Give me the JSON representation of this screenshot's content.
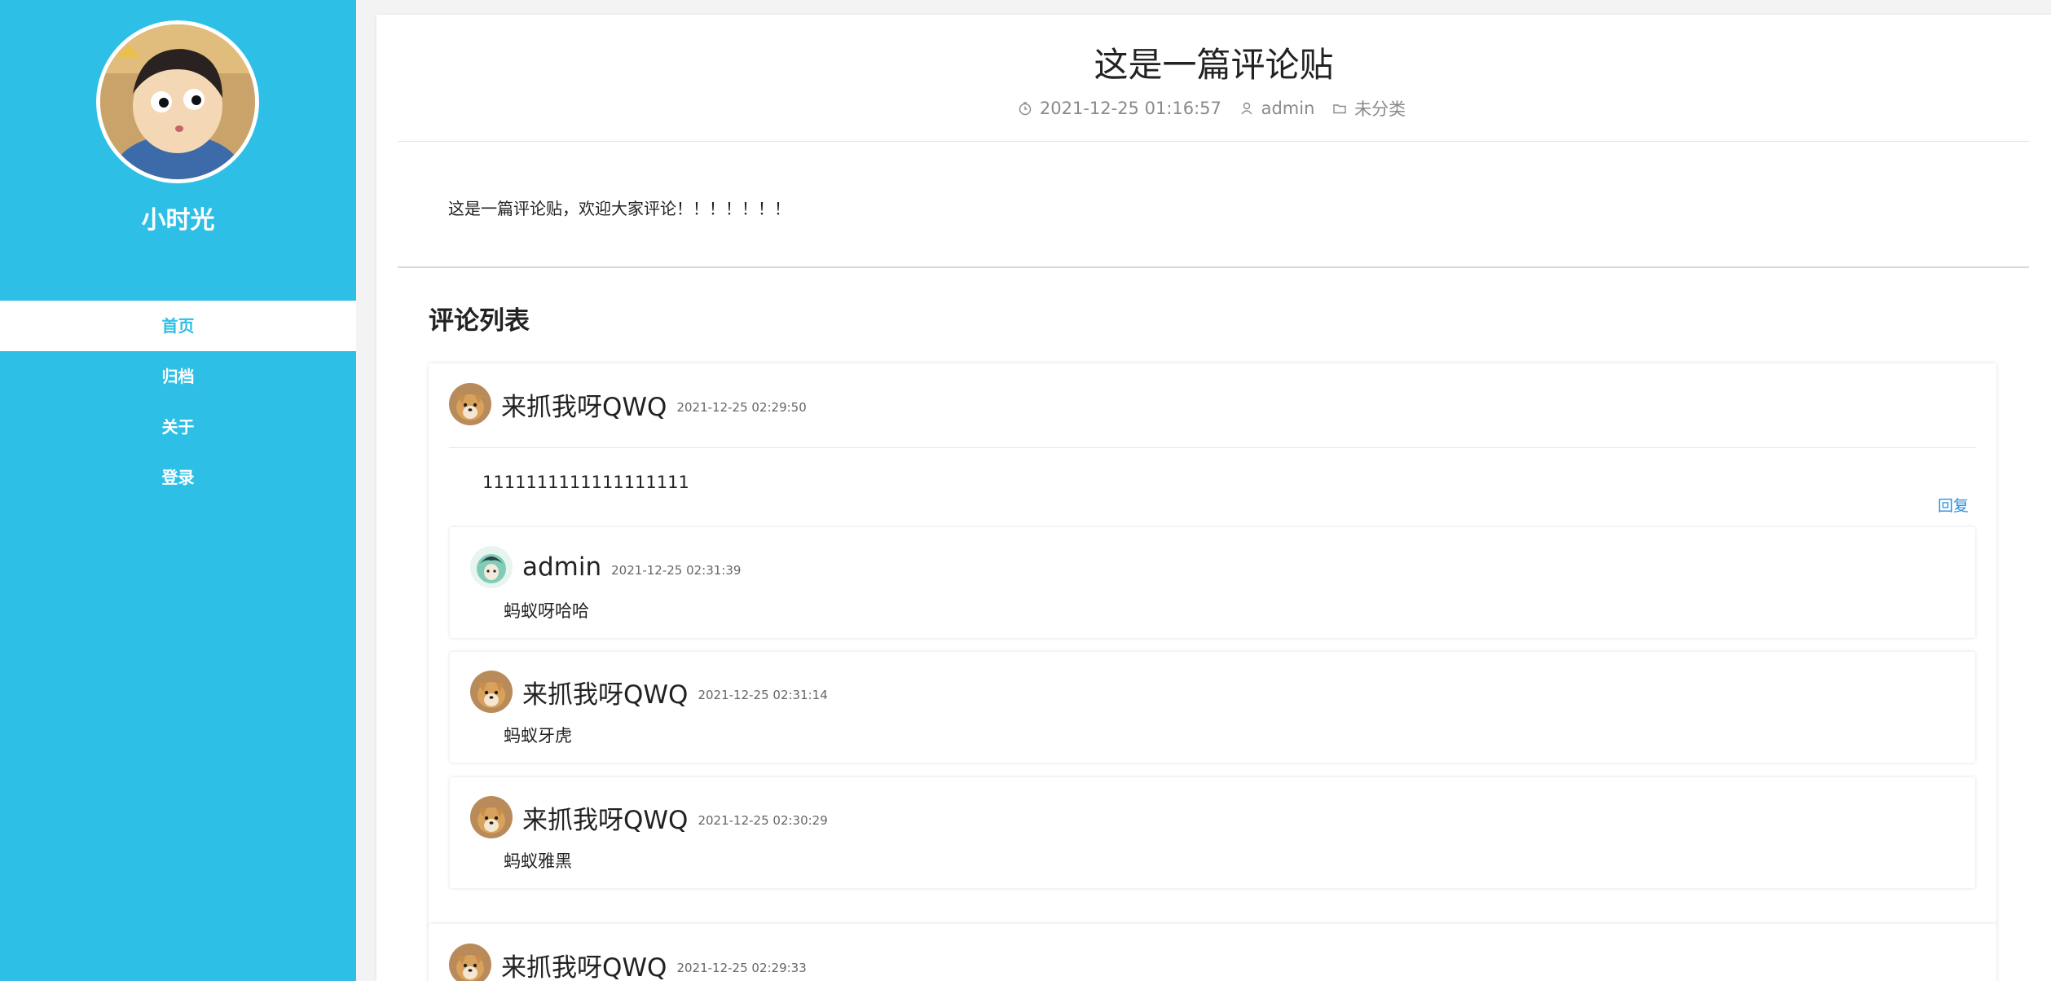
{
  "sidebar": {
    "site_name": "小时光",
    "nav": [
      {
        "label": "首页",
        "active": true
      },
      {
        "label": "归档",
        "active": false
      },
      {
        "label": "关于",
        "active": false
      },
      {
        "label": "登录",
        "active": false
      }
    ]
  },
  "post": {
    "title": "这是一篇评论贴",
    "date": "2021-12-25 01:16:57",
    "author": "admin",
    "category": "未分类",
    "content": "这是一篇评论贴，欢迎大家评论！！！！！！！"
  },
  "comments_heading": "评论列表",
  "comments": [
    {
      "author": "来抓我呀QWQ",
      "time": "2021-12-25 02:29:50",
      "body": "1111111111111111111",
      "reply_label": "回复",
      "replies": [
        {
          "author": "admin",
          "time": "2021-12-25 02:31:39",
          "body": "蚂蚁呀哈哈"
        },
        {
          "author": "来抓我呀QWQ",
          "time": "2021-12-25 02:31:14",
          "body": "蚂蚁牙虎"
        },
        {
          "author": "来抓我呀QWQ",
          "time": "2021-12-25 02:30:29",
          "body": "蚂蚁雅黑"
        }
      ]
    },
    {
      "author": "来抓我呀QWQ",
      "time": "2021-12-25 02:29:33"
    }
  ],
  "colors": {
    "sidebar": "#2ebfe6",
    "link": "#2a8fe0"
  }
}
